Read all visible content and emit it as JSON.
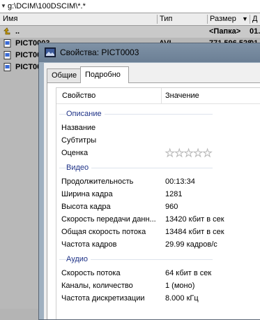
{
  "file_manager": {
    "path": "g:\\DCIM\\100DSCIM\\*.*",
    "columns": {
      "name": "Имя",
      "type": "Тип",
      "size": "Размер",
      "date": "Д"
    },
    "rows": [
      {
        "name": "..",
        "type": "",
        "size": "<Папка>",
        "date": "01."
      },
      {
        "name": "PICT0003",
        "type": "AVI",
        "size": "771 596 528",
        "date": "01"
      },
      {
        "name": "PICT00",
        "type": "",
        "size": "",
        "date": ""
      },
      {
        "name": "PICT00",
        "type": "",
        "size": "",
        "date": ""
      }
    ]
  },
  "dialog": {
    "title": "Свойства: PICT0003",
    "tabs": [
      "Общие",
      "Подробно"
    ],
    "active_tab": "Подробно",
    "columns": {
      "property": "Свойство",
      "value": "Значение"
    },
    "groups": {
      "description": "Описание",
      "video": "Видео",
      "audio": "Аудио"
    },
    "description": [
      {
        "key": "Название",
        "value": ""
      },
      {
        "key": "Субтитры",
        "value": ""
      }
    ],
    "rating": {
      "key": "Оценка",
      "stars": 0,
      "max": 5
    },
    "video": [
      {
        "key": "Продолжительность",
        "value": "00:13:34"
      },
      {
        "key": "Ширина кадра",
        "value": "1281"
      },
      {
        "key": "Высота кадра",
        "value": "960"
      },
      {
        "key": "Скорость передачи данн...",
        "value": "13420 кбит в сек"
      },
      {
        "key": "Общая скорость потока",
        "value": "13484 кбит в сек"
      },
      {
        "key": "Частота кадров",
        "value": "29.99 кадров/с"
      }
    ],
    "audio": [
      {
        "key": "Скорость потока",
        "value": "64 кбит в сек"
      },
      {
        "key": "Каналы, количество",
        "value": "1 (моно)"
      },
      {
        "key": "Частота дискретизации",
        "value": "8.000 кГц"
      }
    ]
  },
  "colors": {
    "group_heading": "#1e3287",
    "titlebar": "#7286a0"
  }
}
